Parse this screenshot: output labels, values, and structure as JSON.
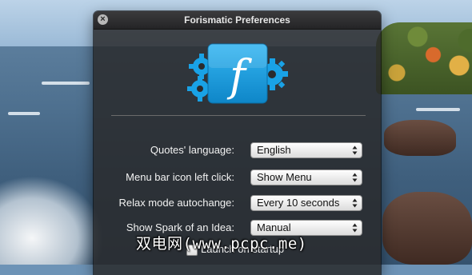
{
  "window": {
    "title": "Forismatic Preferences"
  },
  "logo": {
    "letter": "f",
    "accent_color": "#1a9ee0",
    "gear_color": "#19a2e6"
  },
  "preferences": [
    {
      "label": "Quotes' language:",
      "value": "English"
    },
    {
      "label": "Menu bar icon left click:",
      "value": "Show Menu"
    },
    {
      "label": "Relax mode autochange:",
      "value": "Every 10 seconds"
    },
    {
      "label": "Show Spark of an Idea:",
      "value": "Manual"
    }
  ],
  "launch_on_startup": {
    "label": "Launch on startup",
    "checked": false
  },
  "watermark": "双电网(www.pcpc.me)"
}
